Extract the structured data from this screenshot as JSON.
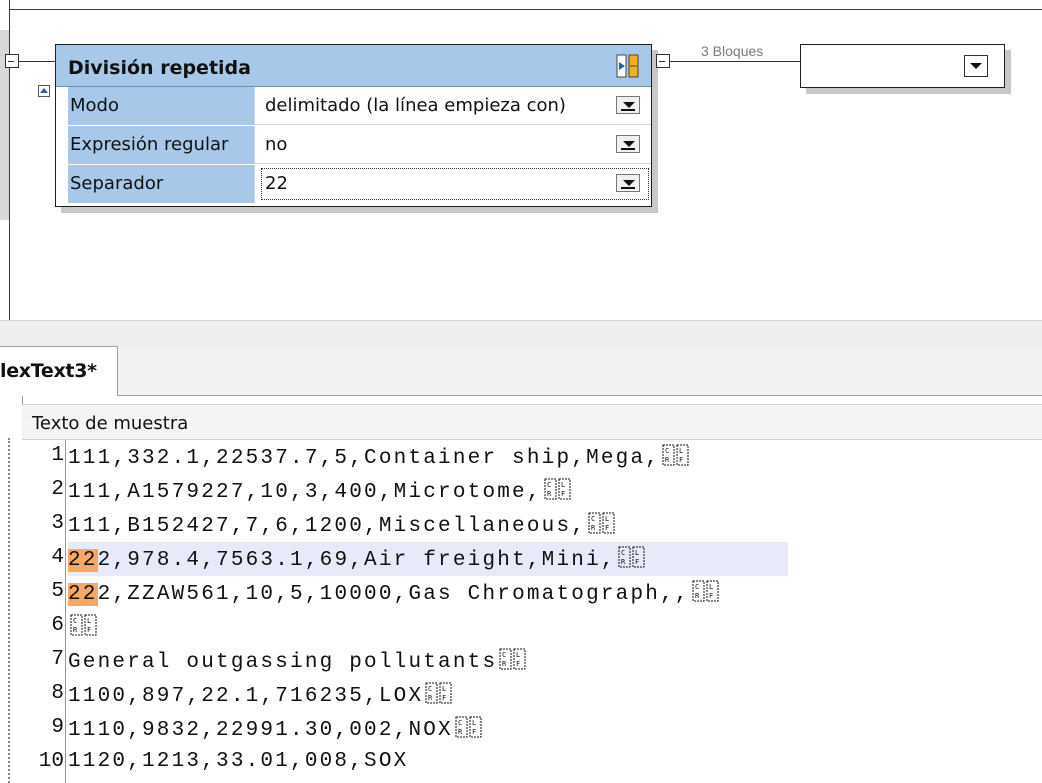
{
  "component": {
    "title": "División repetida",
    "rows": [
      {
        "label": "Modo",
        "value": "delimitado (la línea empieza con)"
      },
      {
        "label": "Expresión regular",
        "value": "no"
      },
      {
        "label": "Separador",
        "value": "22"
      }
    ]
  },
  "connection": {
    "label": "3 Bloques"
  },
  "tab": {
    "label": "lexText3*"
  },
  "panel": {
    "title": "Texto de muestra"
  },
  "sample_lines": [
    {
      "num": "1",
      "prefix": "",
      "text": "111,332.1,22537.7,5,Container ship,Mega,",
      "eol": true
    },
    {
      "num": "2",
      "prefix": "",
      "text": "111,A1579227,10,3,400,Microtome,",
      "eol": true
    },
    {
      "num": "3",
      "prefix": "",
      "text": "111,B152427,7,6,1200,Miscellaneous,",
      "eol": true
    },
    {
      "num": "4",
      "prefix": "22",
      "text": "2,978.4,7563.1,69,Air freight,Mini,",
      "eol": true
    },
    {
      "num": "5",
      "prefix": "22",
      "text": "2,ZZAW561,10,5,10000,Gas Chromatograph,,",
      "eol": true
    },
    {
      "num": "6",
      "prefix": "",
      "text": "",
      "eol": true
    },
    {
      "num": "7",
      "prefix": "",
      "text": "General outgassing pollutants",
      "eol": true
    },
    {
      "num": "8",
      "prefix": "",
      "text": "1100,897,22.1,716235,LOX",
      "eol": true
    },
    {
      "num": "9",
      "prefix": "",
      "text": "1110,9832,22991.30,002,NOX",
      "eol": true
    },
    {
      "num": "10",
      "prefix": "",
      "text": "1120,1213,33.01,008,SOX",
      "eol": false
    }
  ],
  "colors": {
    "component_header": "#a8c8ea",
    "match_highlight": "#f7a862",
    "current_line": "#e8eafa"
  },
  "icons": [
    "output-split-icon",
    "collapse-icon",
    "dropdown-arrow-icon",
    "line-break-icon"
  ]
}
